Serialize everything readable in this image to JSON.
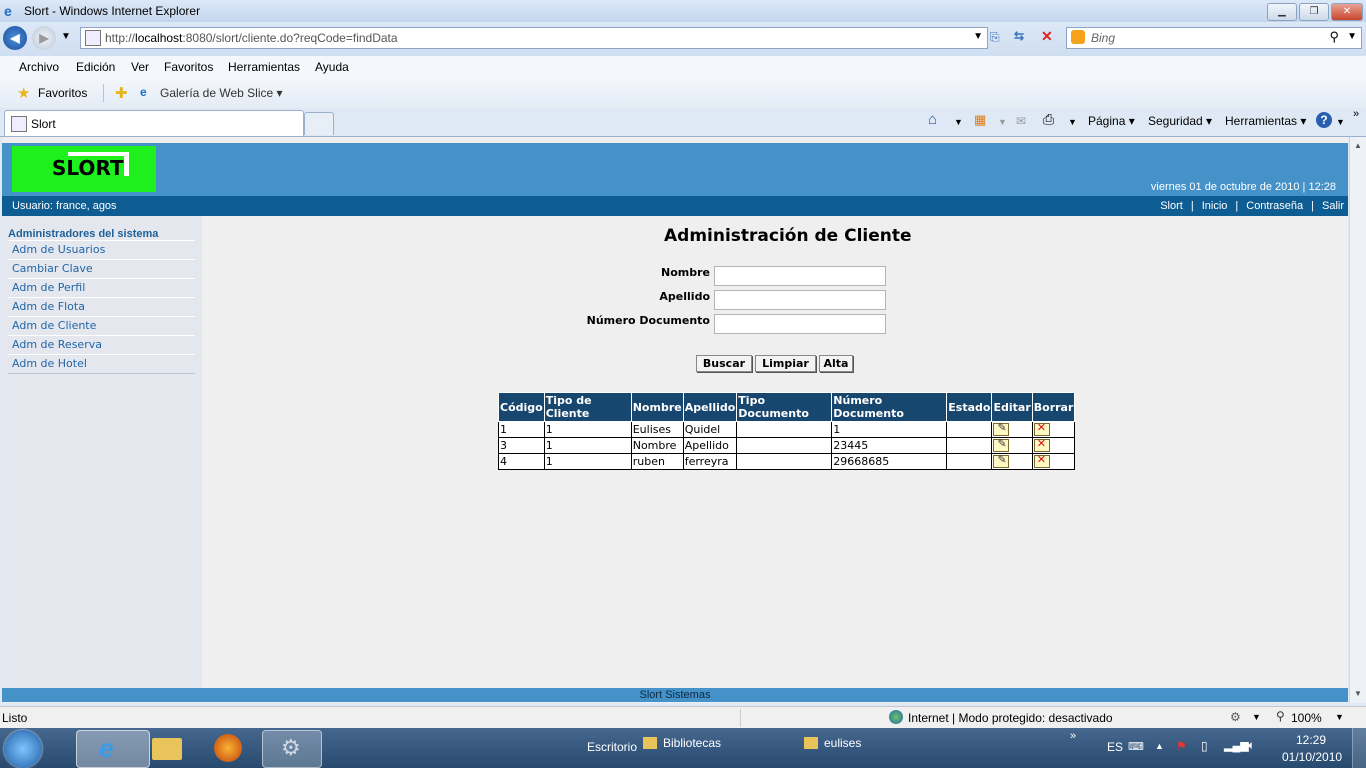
{
  "window": {
    "title": "Slort - Windows Internet Explorer"
  },
  "browser": {
    "url_prefix": "http://",
    "url_host": "localhost",
    "url_rest": ":8080/slort/cliente.do?reqCode=findData",
    "search_placeholder": "Bing",
    "menu": [
      "Archivo",
      "Edición",
      "Ver",
      "Favoritos",
      "Herramientas",
      "Ayuda"
    ],
    "favorites_label": "Favoritos",
    "webslice_label": "Galería de Web Slice",
    "tab_title": "Slort",
    "commands": {
      "pagina": "Página",
      "seguridad": "Seguridad",
      "herramientas": "Herramientas"
    }
  },
  "page": {
    "logo": "SLORT",
    "date": "viernes 01 de octubre de 2010 | 12:28",
    "user": "Usuario: france, agos",
    "top_links": [
      "Slort",
      "|",
      "Inicio",
      "|",
      "Contraseña",
      "|",
      "Salir"
    ],
    "sidebar": {
      "header": "Administradores del sistema",
      "items": [
        "Adm de Usuarios",
        "Cambiar Clave",
        "Adm de Perfil",
        "Adm de Flota",
        "Adm de Cliente",
        "Adm de Reserva",
        "Adm de Hotel"
      ]
    },
    "title": "Administración de Cliente",
    "form": {
      "nombre_label": "Nombre",
      "apellido_label": "Apellido",
      "documento_label": "Número Documento",
      "nombre_value": "",
      "apellido_value": "",
      "documento_value": ""
    },
    "buttons": {
      "buscar": "Buscar",
      "limpiar": "Limpiar",
      "alta": "Alta"
    },
    "table": {
      "headers": [
        "Código",
        "Tipo de Cliente",
        "Nombre",
        "Apellido",
        "Tipo Documento",
        "Número Documento",
        "Estado",
        "Editar",
        "Borrar"
      ],
      "rows": [
        [
          "1",
          "1",
          "Eulises",
          "Quidel",
          "",
          "1",
          ""
        ],
        [
          "3",
          "1",
          "Nombre",
          "Apellido",
          "",
          "23445",
          ""
        ],
        [
          "4",
          "1",
          "ruben",
          "ferreyra",
          "",
          "29668685",
          ""
        ]
      ]
    },
    "footer": "Slort Sistemas"
  },
  "statusbar": {
    "left": "Listo",
    "zone": "Internet | Modo protegido: desactivado",
    "zoom": "100%"
  },
  "taskbar": {
    "escritorio": "Escritorio",
    "bibliotecas": "Bibliotecas",
    "eulises": "eulises",
    "lang": "ES",
    "time": "12:29",
    "date": "01/10/2010"
  }
}
